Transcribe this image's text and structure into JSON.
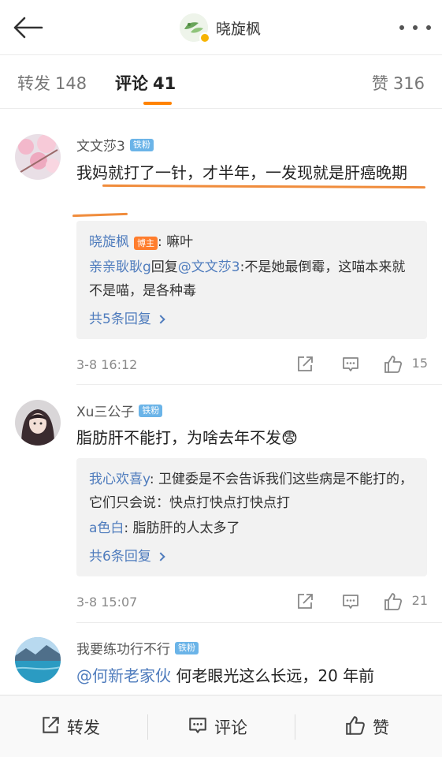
{
  "header": {
    "title": "晓旋枫"
  },
  "tabs": {
    "repost_label": "转发",
    "repost_count": "148",
    "comment_label": "评论",
    "comment_count": "41",
    "like_label": "赞",
    "like_count": "316"
  },
  "comments": [
    {
      "user": "文文莎3",
      "badge": "铁粉",
      "text": "我妈就打了一针，才半年，一发现就是肝癌晚期",
      "replies": [
        {
          "name": "晓旋枫",
          "badge": "博主",
          "text": ": 嘛叶"
        },
        {
          "name": "亲亲耿耿g",
          "mid": "回复",
          "name2": "@文文莎3",
          "text": ":不是她最倒霉，这喵本来就不是喵，是各种毒"
        }
      ],
      "more_replies": "共5条回复",
      "date": "3-8 16:12",
      "likes": "15"
    },
    {
      "user": "Xu三公子",
      "badge": "铁粉",
      "text": "脂肪肝不能打，为啥去年不发😨",
      "replies": [
        {
          "name": "我心欢喜y",
          "text": ": 卫健委是不会告诉我们这些病是不能打的，它们只会说：快点打快点打快点打"
        },
        {
          "name": "a色白",
          "text": ": 脂肪肝的人太多了"
        }
      ],
      "more_replies": "共6条回复",
      "date": "3-8 15:07",
      "likes": "21"
    },
    {
      "user": "我要练功行不行",
      "badge": "铁粉",
      "mention": "@何新老家伙",
      "text": " 何老眼光这么长远，20 年前"
    }
  ],
  "bottom": {
    "share": "转发",
    "comment": "评论",
    "like": "赞"
  },
  "colors": {
    "accent": "#ff8200",
    "link": "#4f7cbd",
    "badge_fan": "#6bb4e8",
    "badge_host": "#ff7d2d"
  },
  "icons": [
    "back-arrow-icon",
    "more-dots-icon",
    "share-icon",
    "comment-icon",
    "like-icon",
    "chevron-right-icon"
  ]
}
